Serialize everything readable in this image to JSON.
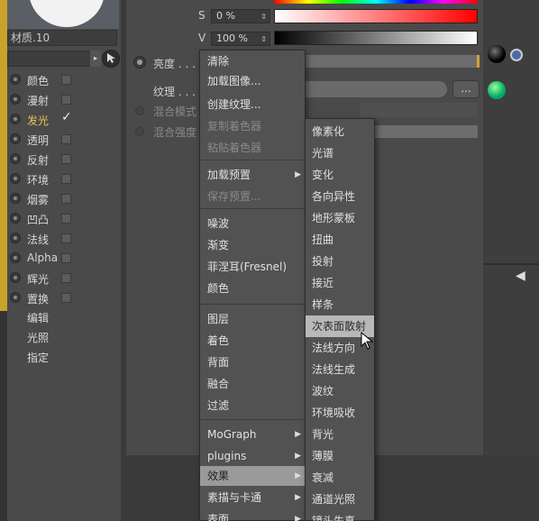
{
  "material": {
    "name": "材质.10"
  },
  "channels": [
    {
      "label": "颜色",
      "checked": false,
      "active": false
    },
    {
      "label": "漫射",
      "checked": false,
      "active": false
    },
    {
      "label": "发光",
      "checked": true,
      "active": true
    },
    {
      "label": "透明",
      "checked": false,
      "active": false
    },
    {
      "label": "反射",
      "checked": false,
      "active": false
    },
    {
      "label": "环境",
      "checked": false,
      "active": false
    },
    {
      "label": "烟雾",
      "checked": false,
      "active": false
    },
    {
      "label": "凹凸",
      "checked": false,
      "active": false
    },
    {
      "label": "法线",
      "checked": false,
      "active": false
    },
    {
      "label": "Alpha",
      "checked": false,
      "active": false
    },
    {
      "label": "辉光",
      "checked": false,
      "active": false
    },
    {
      "label": "置换",
      "checked": false,
      "active": false
    }
  ],
  "extra_items": [
    "编辑",
    "光照",
    "指定"
  ],
  "color_params": {
    "s_label": "S",
    "s_value": "0 %",
    "v_label": "V",
    "v_value": "100 %"
  },
  "emission": {
    "brightness_label": "亮度 . . . . .",
    "texture_label": "纹理 . . . . .",
    "texture_button": "...",
    "blend_mode_label": "混合模式",
    "blend_strength_label": "混合强度"
  },
  "context_menu": {
    "items": [
      {
        "label": "清除",
        "disabled": false
      },
      {
        "label": "加载图像...",
        "disabled": false
      },
      {
        "label": "创建纹理...",
        "disabled": false
      },
      {
        "label": "复制着色器",
        "disabled": true
      },
      {
        "label": "粘贴着色器",
        "disabled": true
      },
      {
        "label": "加载预置",
        "disabled": false,
        "submenu": true
      },
      {
        "label": "保存预置...",
        "disabled": true
      },
      {
        "label": "噪波",
        "disabled": false
      },
      {
        "label": "渐变",
        "disabled": false
      },
      {
        "label": "菲涅耳(Fresnel)",
        "disabled": false
      },
      {
        "label": "颜色",
        "disabled": false
      },
      {
        "label": "图层",
        "disabled": false
      },
      {
        "label": "着色",
        "disabled": false
      },
      {
        "label": "背面",
        "disabled": false
      },
      {
        "label": "融合",
        "disabled": false
      },
      {
        "label": "过滤",
        "disabled": false
      },
      {
        "label": "MoGraph",
        "disabled": false,
        "submenu": true
      },
      {
        "label": "plugins",
        "disabled": false,
        "submenu": true
      },
      {
        "label": "效果",
        "disabled": false,
        "submenu": true,
        "selected": true
      },
      {
        "label": "素描与卡通",
        "disabled": false,
        "submenu": true
      },
      {
        "label": "表面",
        "disabled": false,
        "submenu": true
      }
    ]
  },
  "effects_submenu": {
    "items": [
      "像素化",
      "光谱",
      "变化",
      "各向异性",
      "地形蒙板",
      "扭曲",
      "投射",
      "接近",
      "样条",
      "次表面散射",
      "法线方向",
      "法线生成",
      "波纹",
      "环境吸收",
      "背光",
      "薄膜",
      "衰减",
      "通道光照",
      "镜头失真"
    ],
    "highlighted": "次表面散射"
  },
  "colors": {
    "accent_yellow": "#c8a22a",
    "highlight": "#b8b8b8"
  }
}
